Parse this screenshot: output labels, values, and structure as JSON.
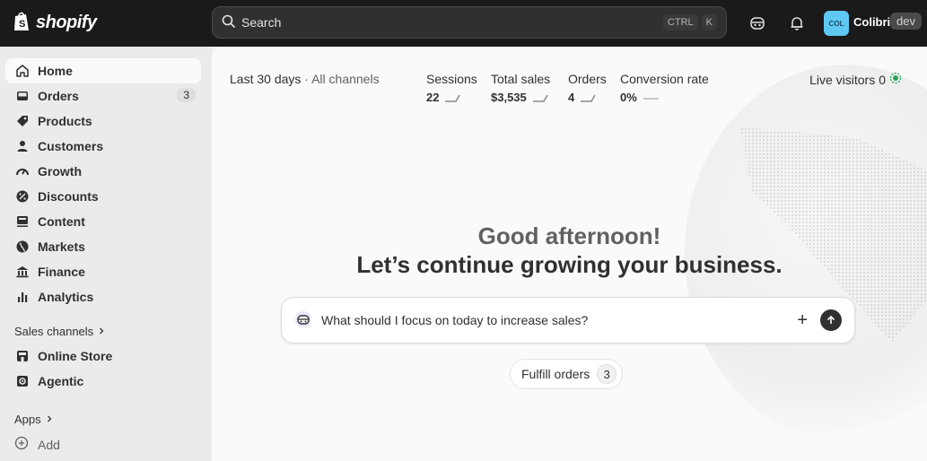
{
  "topbar": {
    "logo_text": "shopify",
    "search_placeholder": "Search",
    "shortcut_keys": [
      "CTRL",
      "K"
    ],
    "store_initials": "COL",
    "store_name": "Colibri",
    "store_tag": "dev",
    "icons": [
      "shopify-bag-icon",
      "search-icon",
      "sidekick-icon",
      "bell-icon"
    ]
  },
  "sidebar": {
    "items": [
      {
        "label": "Home",
        "icon": "home-icon",
        "active": true
      },
      {
        "label": "Orders",
        "icon": "inbox-icon",
        "badge": "3"
      },
      {
        "label": "Products",
        "icon": "tag-icon"
      },
      {
        "label": "Customers",
        "icon": "person-icon"
      },
      {
        "label": "Growth",
        "icon": "gauge-icon"
      },
      {
        "label": "Discounts",
        "icon": "discount-icon"
      },
      {
        "label": "Content",
        "icon": "content-icon"
      },
      {
        "label": "Markets",
        "icon": "globe-icon"
      },
      {
        "label": "Finance",
        "icon": "bank-icon"
      },
      {
        "label": "Analytics",
        "icon": "bar-chart-icon"
      }
    ],
    "sales_channels_label": "Sales channels",
    "channels": [
      {
        "label": "Online Store",
        "icon": "store-icon"
      },
      {
        "label": "Agentic",
        "icon": "agentic-icon"
      }
    ],
    "apps_label": "Apps",
    "add_label": "Add"
  },
  "metrics": {
    "range": "Last 30 days",
    "separator": "·",
    "channels": "All channels",
    "items": [
      {
        "label": "Sessions",
        "value": "22"
      },
      {
        "label": "Total sales",
        "value": "$3,535"
      },
      {
        "label": "Orders",
        "value": "4"
      },
      {
        "label": "Conversion rate",
        "value": "0%"
      }
    ],
    "live_label": "Live visitors",
    "live_value": "0"
  },
  "greeting": {
    "line1": "Good afternoon!",
    "line2": "Let’s continue growing your business."
  },
  "prompt": {
    "text": "What should I focus on today to increase sales?"
  },
  "chip": {
    "label": "Fulfill orders",
    "count": "3"
  },
  "colors": {
    "topbar": "#1a1a1a",
    "sidebar": "#ebebeb",
    "main": "#fafafa",
    "live_indicator": "#29a35a",
    "store_badge": "#5ec8f2"
  }
}
